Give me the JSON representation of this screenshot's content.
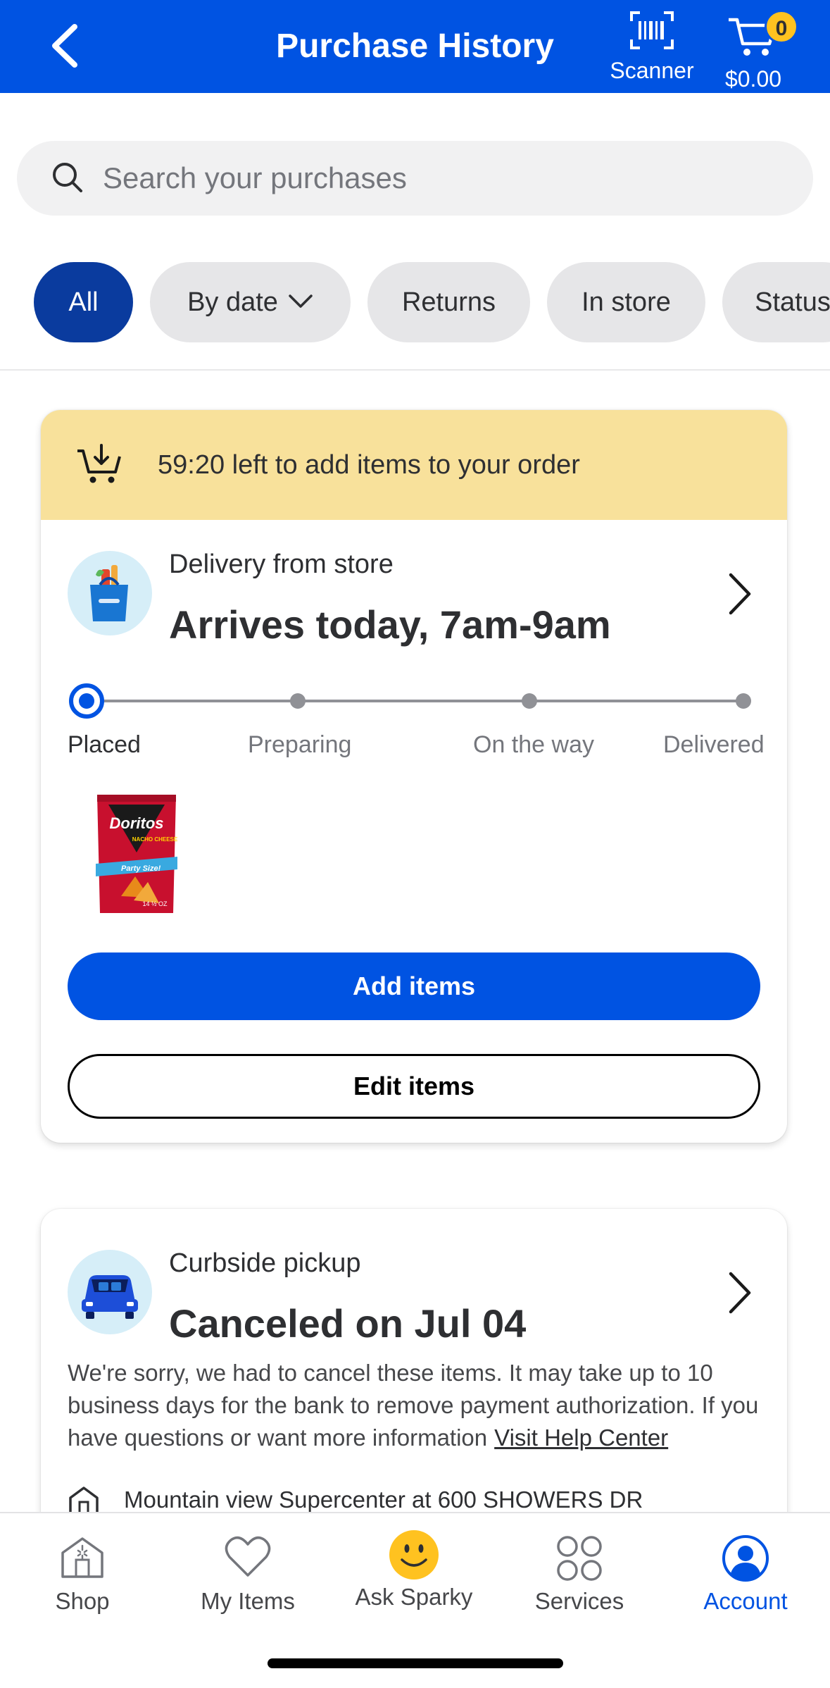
{
  "header": {
    "title": "Purchase History",
    "scanner_label": "Scanner",
    "cart_count": "0",
    "cart_total": "$0.00"
  },
  "search": {
    "placeholder": "Search your purchases"
  },
  "filters": [
    "All",
    "By date",
    "Returns",
    "In store",
    "Status"
  ],
  "active_order": {
    "banner": "59:20 left to add items to your order",
    "type": "Delivery from store",
    "status": "Arrives today, 7am-9am",
    "steps": [
      "Placed",
      "Preparing",
      "On the way",
      "Delivered"
    ],
    "current_step": "Placed",
    "product_brand": "Doritos",
    "product_flavor": "NACHO CHEESE",
    "product_size": "Party Size!",
    "product_weight": "14 ½ OZ",
    "add_label": "Add items",
    "edit_label": "Edit items"
  },
  "canceled_order": {
    "type": "Curbside pickup",
    "status": "Canceled on Jul 04",
    "message": "We're sorry, we had to cancel these items. It may take up to 10 business days for the bank to remove payment authorization. If you have questions or want more information",
    "help_link": "Visit Help Center",
    "store": "Mountain view Supercenter at 600 SHOWERS DR"
  },
  "tabs": [
    "Shop",
    "My Items",
    "Ask Sparky",
    "Services",
    "Account"
  ],
  "active_tab": "Account",
  "colors": {
    "brand_blue": "#0053e2",
    "active_chip": "#0a3b9e",
    "banner_yellow": "#f8e19b",
    "badge_yellow": "#ffc220"
  }
}
